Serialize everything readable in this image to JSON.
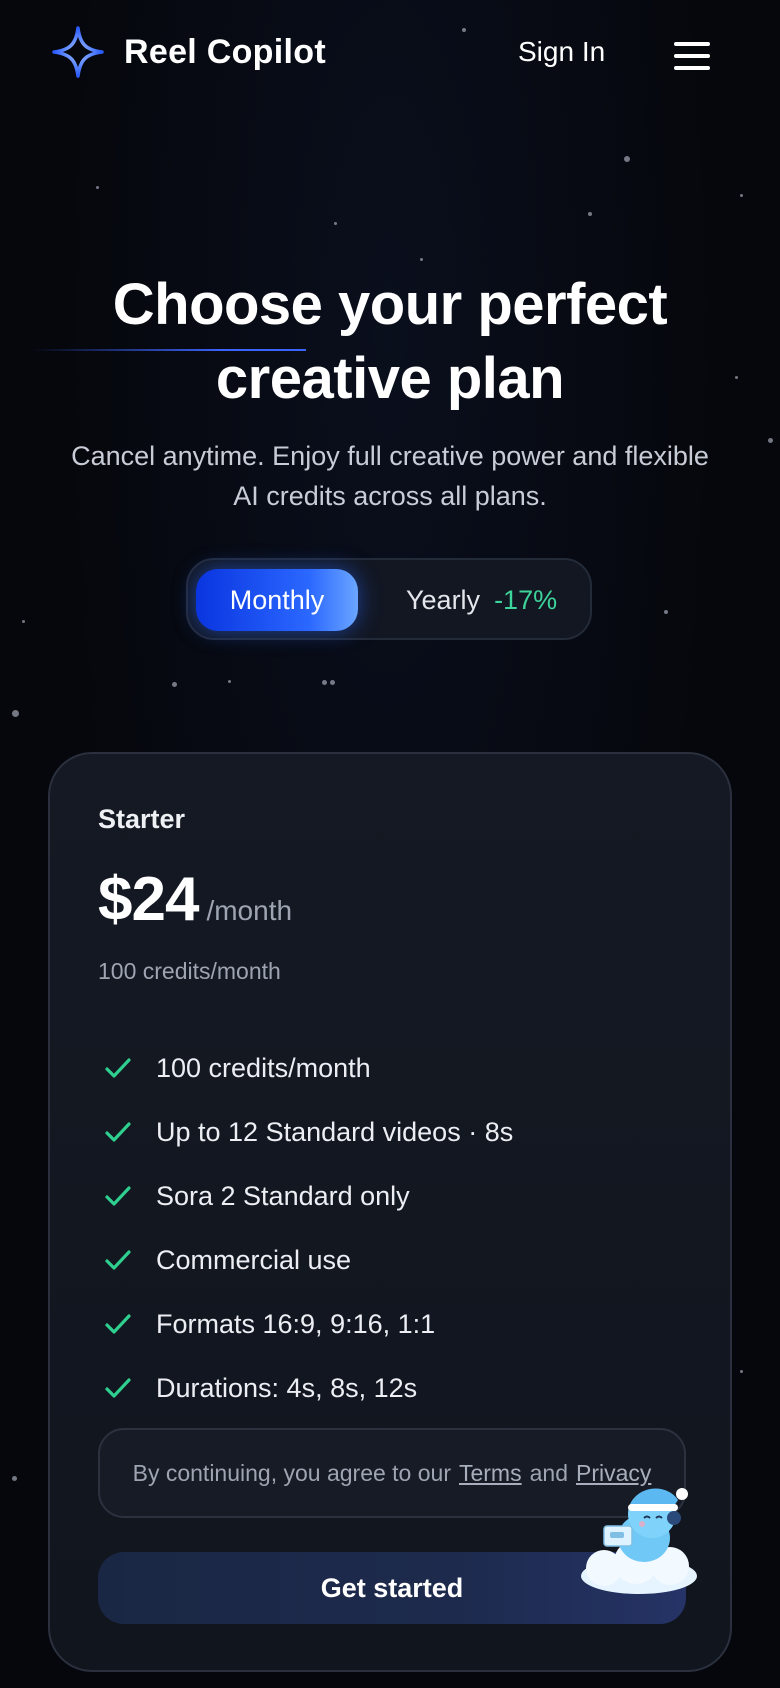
{
  "header": {
    "brand": "Reel Copilot",
    "sign_in_label": "Sign In",
    "menu_icon": "hamburger-menu-icon",
    "logo_icon": "sparkle-star-icon"
  },
  "hero": {
    "title_line1": "Choose your perfect",
    "title_line2": "creative plan",
    "subtitle_line1": "Cancel anytime. Enjoy full creative power and flexible",
    "subtitle_line2": "AI credits across all plans."
  },
  "billing_toggle": {
    "options": [
      {
        "label": "Monthly",
        "selected": true
      },
      {
        "label": "Yearly",
        "badge": "-17%",
        "selected": false
      }
    ]
  },
  "plan": {
    "name": "Starter",
    "price": "$24",
    "period": "/month",
    "credits": "100 credits/month",
    "features": [
      "100 credits/month",
      "Up to 12 Standard videos · 8s",
      "Sora 2 Standard only",
      "Commercial use",
      "Formats 16:9, 9:16, 1:1",
      "Durations: 4s, 8s, 12s"
    ],
    "terms": {
      "prefix": "By continuing, you agree to our",
      "terms_link": "Terms",
      "conjunction": "and",
      "privacy_link": "Privacy"
    },
    "cta_label": "Get started"
  },
  "colors": {
    "background": "#05070c",
    "accent_blue": "#2b68ff",
    "discount_green": "#3ed39a",
    "check_green": "#2fcf8f"
  },
  "assistant": {
    "icon": "support-mascot-icon"
  }
}
